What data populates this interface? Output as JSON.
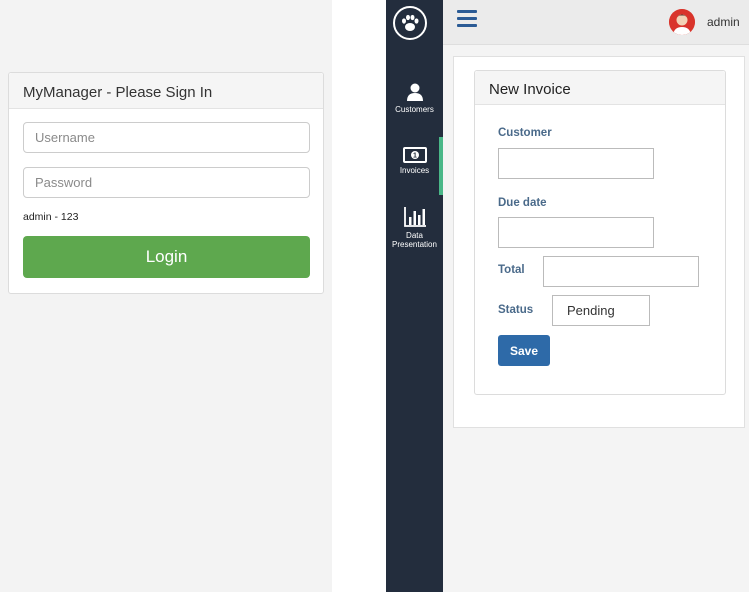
{
  "login": {
    "title": "MyManager - Please Sign In",
    "username_placeholder": "Username",
    "password_placeholder": "Password",
    "hint": "admin - 123",
    "login_label": "Login"
  },
  "sidebar": {
    "items": [
      {
        "label": "Customers",
        "icon": "user-icon"
      },
      {
        "label": "Invoices",
        "icon": "money-icon"
      },
      {
        "label": "Data Presentation",
        "icon": "bar-chart-icon"
      }
    ],
    "active_item": "Invoices"
  },
  "topbar": {
    "username": "admin"
  },
  "invoice": {
    "title": "New Invoice",
    "customer_label": "Customer",
    "customer_value": "",
    "due_date_label": "Due date",
    "due_date_value": "",
    "total_label": "Total",
    "total_value": "",
    "status_label": "Status",
    "status_value": "Pending",
    "save_label": "Save"
  },
  "colors": {
    "login_button": "#5ea84e",
    "sidebar_bg": "#232d3d",
    "active_indicator": "#4ab788",
    "save_button": "#2e6aa8",
    "menu_icon": "#2b5b95",
    "label_text": "#4a6a8a"
  }
}
